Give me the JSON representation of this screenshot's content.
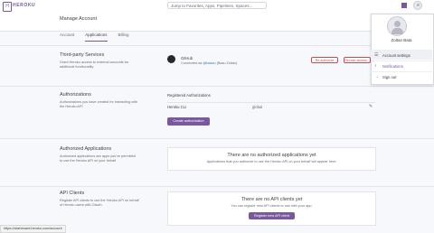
{
  "topbar": {
    "brand": "HEROKU",
    "logo_glyph": "H",
    "search_placeholder": "Jump to Favorites, Apps, Pipelines, Spaces..."
  },
  "header": {
    "title": "Manage Account"
  },
  "tabs": [
    {
      "label": "Account",
      "active": false
    },
    {
      "label": "Applications",
      "active": true
    },
    {
      "label": "Billing",
      "active": false
    }
  ],
  "third_party": {
    "title": "Third-party Services",
    "desc": "Grant Heroku access to external accounts for additional functionality",
    "service_name": "GitHub",
    "connected_prefix": "Connected as",
    "connected_user": "@bazzu",
    "connected_suffix": "(Bazu Zoltan)",
    "reauthorize": "Re-authorize",
    "revoke": "Revoke access..."
  },
  "authorizations": {
    "title": "Authorizations",
    "desc": "Authorizations you have created for interacting with the Heroku API",
    "list_title": "Registered Authorizations",
    "rows": [
      {
        "name": "Heroku CLI",
        "scope": "global"
      }
    ],
    "create_button": "Create authorization"
  },
  "authorized_apps": {
    "title": "Authorized Applications",
    "desc": "Authorized applications are apps you've permitted to use the Heroku API on your behalf",
    "empty_title": "There are no authorized applications yet",
    "empty_sub": "Applications that you authorize to use the Heroku API on your behalf will appear here."
  },
  "api_clients": {
    "title": "API Clients",
    "desc": "Register API clients to use the Heroku API on behalf of Heroku users with OAuth.",
    "empty_title": "There are no API clients yet",
    "empty_sub": "You can register new API clients to use with your app.",
    "register_button": "Register new API client"
  },
  "dropdown": {
    "name": "Zoltan Bata",
    "items": [
      {
        "label": "Account settings",
        "icon": "list-icon"
      },
      {
        "label": "Notifications",
        "icon": "bell-icon"
      },
      {
        "label": "Sign out",
        "icon": "sign-out-icon"
      }
    ]
  },
  "status_url": "https://dashboard.heroku.com/account"
}
